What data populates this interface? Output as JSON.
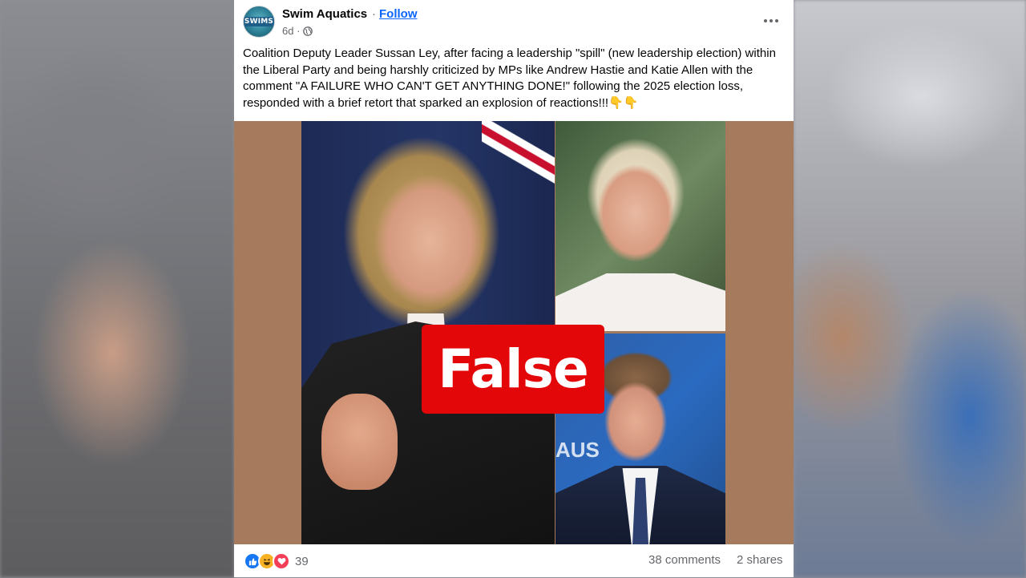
{
  "post": {
    "page_name": "Swim Aquatics",
    "separator": "·",
    "follow_label": "Follow",
    "age": "6d ·",
    "avatar_text": "SWIMS",
    "text": "Coalition Deputy Leader Sussan Ley, after facing a leadership \"spill\" (new leadership election) within the Liberal Party and being harshly criticized by MPs like Andrew Hastie and Katie Allen with the comment \"A FAILURE WHO CAN'T GET ANYTHING DONE!\" following the 2025 election loss, responded with a brief retort that sparked an explosion of reactions!!!👇👇"
  },
  "media": {
    "badge_label": "False",
    "badge_color": "#e3070a",
    "background_sign_text": "AUS"
  },
  "footer": {
    "reaction_count": "39",
    "reactions": [
      "like-icon",
      "haha-icon",
      "love-icon"
    ],
    "comments": "38 comments",
    "shares": "2 shares"
  },
  "colors": {
    "link": "#0866ff",
    "secondary_text": "#65676b",
    "media_background": "#a67a5d"
  }
}
